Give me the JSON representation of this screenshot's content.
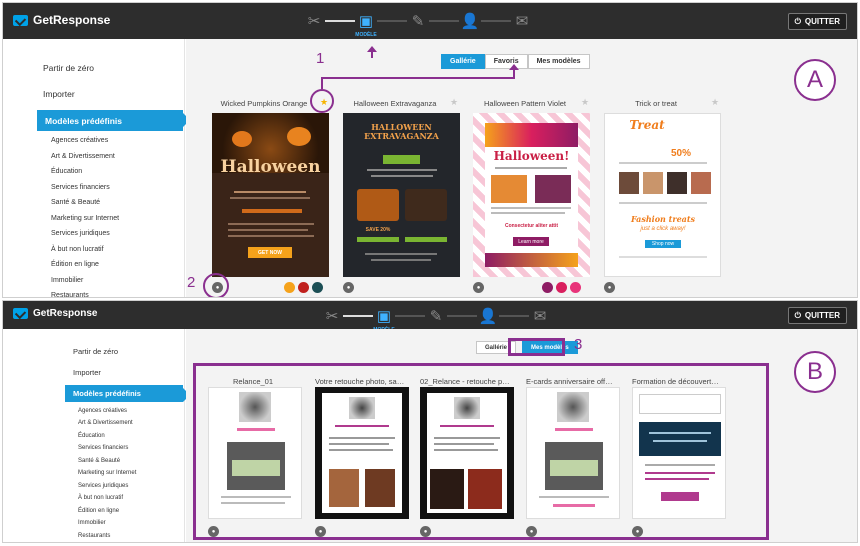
{
  "app": {
    "brand": "GetResponse",
    "quit_label": "QUITTER",
    "step_label": "MODÈLE"
  },
  "sidebar": {
    "main": [
      "Partir de zéro",
      "Importer"
    ],
    "active": "Modèles prédéfinis",
    "categories": [
      "Agences créatives",
      "Art & Divertissement",
      "Éducation",
      "Services financiers",
      "Santé & Beauté",
      "Marketing sur Internet",
      "Services juridiques",
      "À but non lucratif",
      "Édition en ligne",
      "Immobilier",
      "Restaurants"
    ]
  },
  "panelA": {
    "letter": "A",
    "tabs": [
      "Gallérie",
      "Favoris",
      "Mes modèles"
    ],
    "active_tab": "Gallérie",
    "templates": [
      {
        "name": "Wicked Pumpkins Orange",
        "headline": "Halloween",
        "button": "GET NOW",
        "swatches": [
          "#f5a21b",
          "#c0201d",
          "#1c4f55"
        ]
      },
      {
        "name": "Halloween Extravaganza",
        "headline": "HALLOWEEN EXTRAVAGANZA",
        "promo": "SAVE 20%"
      },
      {
        "name": "Halloween Pattern Violet",
        "headline": "Halloween!",
        "sub": "Consectetur aliter attit",
        "button": "Learn more",
        "swatches": [
          "#8e1c64",
          "#d91f5e",
          "#e8347a"
        ]
      },
      {
        "name": "Trick or treat",
        "headline": "Treat",
        "promo": "50%",
        "footer": "Fashion treats",
        "tagline": "just a click away!",
        "button": "Shop now"
      }
    ],
    "callouts": [
      "1",
      "2"
    ]
  },
  "panelB": {
    "letter": "B",
    "tabs": [
      "Gallérie",
      "Mes modèles"
    ],
    "active_tab": "Mes modèles",
    "templates": [
      {
        "name": "Relance_01"
      },
      {
        "name": "Votre retouche photo, sans ..."
      },
      {
        "name": "02_Relance - retouche photo"
      },
      {
        "name": "E-cards anniversaire offerte..."
      },
      {
        "name": "Formation de découverte P..."
      }
    ],
    "callouts": [
      "3"
    ]
  },
  "colors": {
    "accent": "#1b9ad8",
    "topbar": "#2d2d2d",
    "annotation": "#8a2f8f"
  },
  "icons": [
    "getresponse-logo-icon",
    "tools-icon",
    "template-icon",
    "edit-icon",
    "contacts-icon",
    "send-icon",
    "power-icon",
    "star-icon",
    "eye-icon"
  ]
}
